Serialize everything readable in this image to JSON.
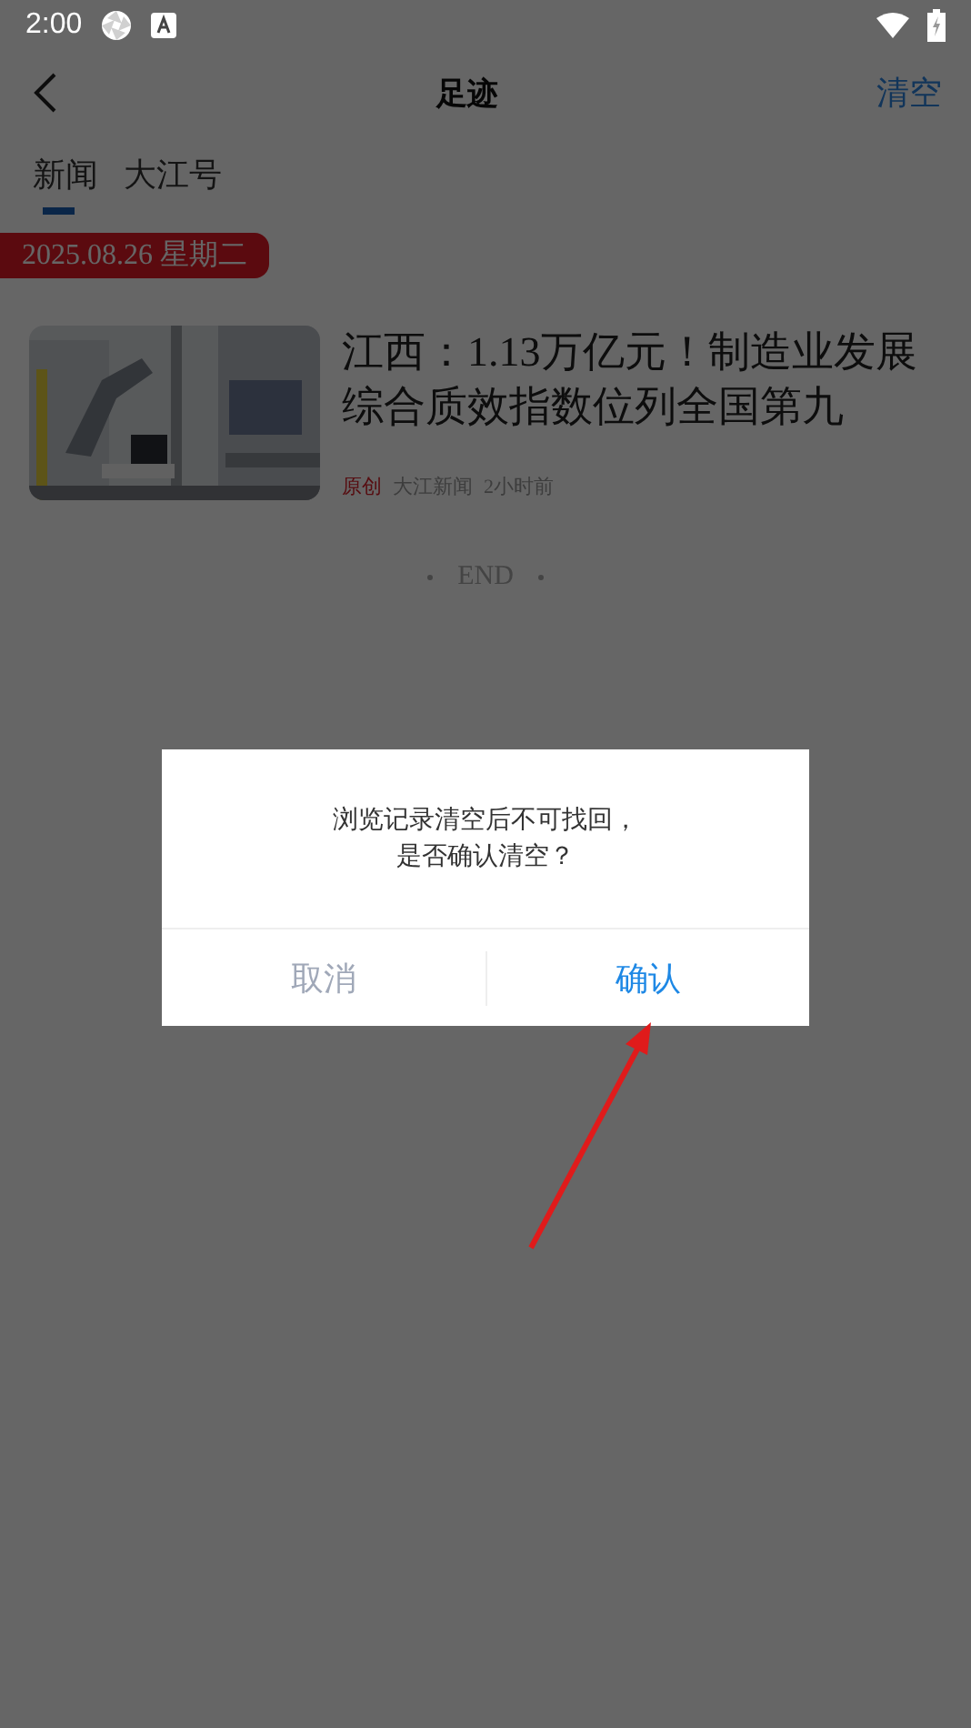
{
  "status_bar": {
    "time": "2:00"
  },
  "header": {
    "title": "足迹",
    "action": "清空"
  },
  "tabs": [
    {
      "label": "新闻",
      "selected": true
    },
    {
      "label": "大江号",
      "selected": false
    }
  ],
  "date_tag": "2025.08.26 星期二",
  "articles": [
    {
      "title": "江西：1.13万亿元！制造业发展综合质效指数位列全国第九",
      "badge": "原创",
      "source": "大江新闻",
      "time": "2小时前"
    }
  ],
  "end_marker": "END",
  "dialog": {
    "message": [
      "浏览记录清空后不可找回，",
      "是否确认清空？"
    ],
    "buttons": [
      {
        "label": "取消",
        "kind": "cancel"
      },
      {
        "label": "确认",
        "kind": "confirm"
      }
    ]
  }
}
